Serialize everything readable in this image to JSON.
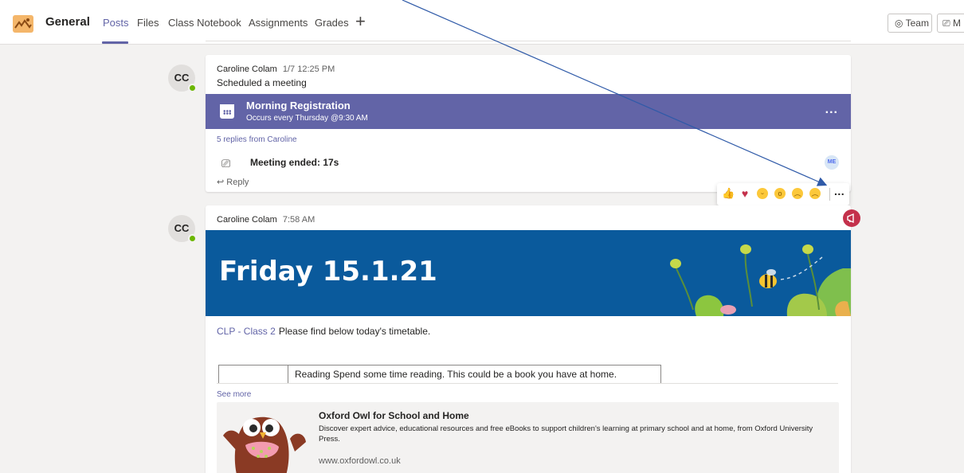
{
  "header": {
    "channel": "General",
    "tabs": [
      "Posts",
      "Files",
      "Class Notebook",
      "Assignments",
      "Grades"
    ],
    "add_tab": "+",
    "team_button": "Team",
    "meet_button": "M"
  },
  "posts": [
    {
      "initials": "CC",
      "author": "Caroline Colam",
      "time": "1/7 12:25 PM",
      "action": "Scheduled a meeting",
      "meeting_title": "Morning Registration",
      "meeting_sub": "Occurs every Thursday @9:30 AM",
      "meeting_more": "...",
      "replies": "5 replies from Caroline",
      "meeting_ended": "Meeting ended: 17s",
      "participant": "ME",
      "reply": "Reply"
    },
    {
      "initials": "CC",
      "author": "Caroline Colam",
      "time": "7:58 AM",
      "banner_title": "Friday 15.1.21",
      "mention": "CLP - Class 2",
      "body": "Please find below today's timetable.",
      "timetable_text": "Reading Spend some time reading. This could be a book you have at home.",
      "see_more": "See more",
      "link": {
        "title": "Oxford Owl for School and Home",
        "description": "Discover expert advice, educational resources and free eBooks to support children's learning at primary school and at home, from Oxford University Press.",
        "url": "www.oxfordowl.co.uk"
      }
    }
  ],
  "reactions": [
    "like",
    "heart",
    "laugh",
    "surprised",
    "sad",
    "angry"
  ],
  "reactions_more": "...",
  "colors": {
    "accent": "#6264a7",
    "banner": "#0a5a9c",
    "presence": "#6bb700",
    "announcement": "#c4314b",
    "annotation_arrow": "#2f5aa8"
  }
}
